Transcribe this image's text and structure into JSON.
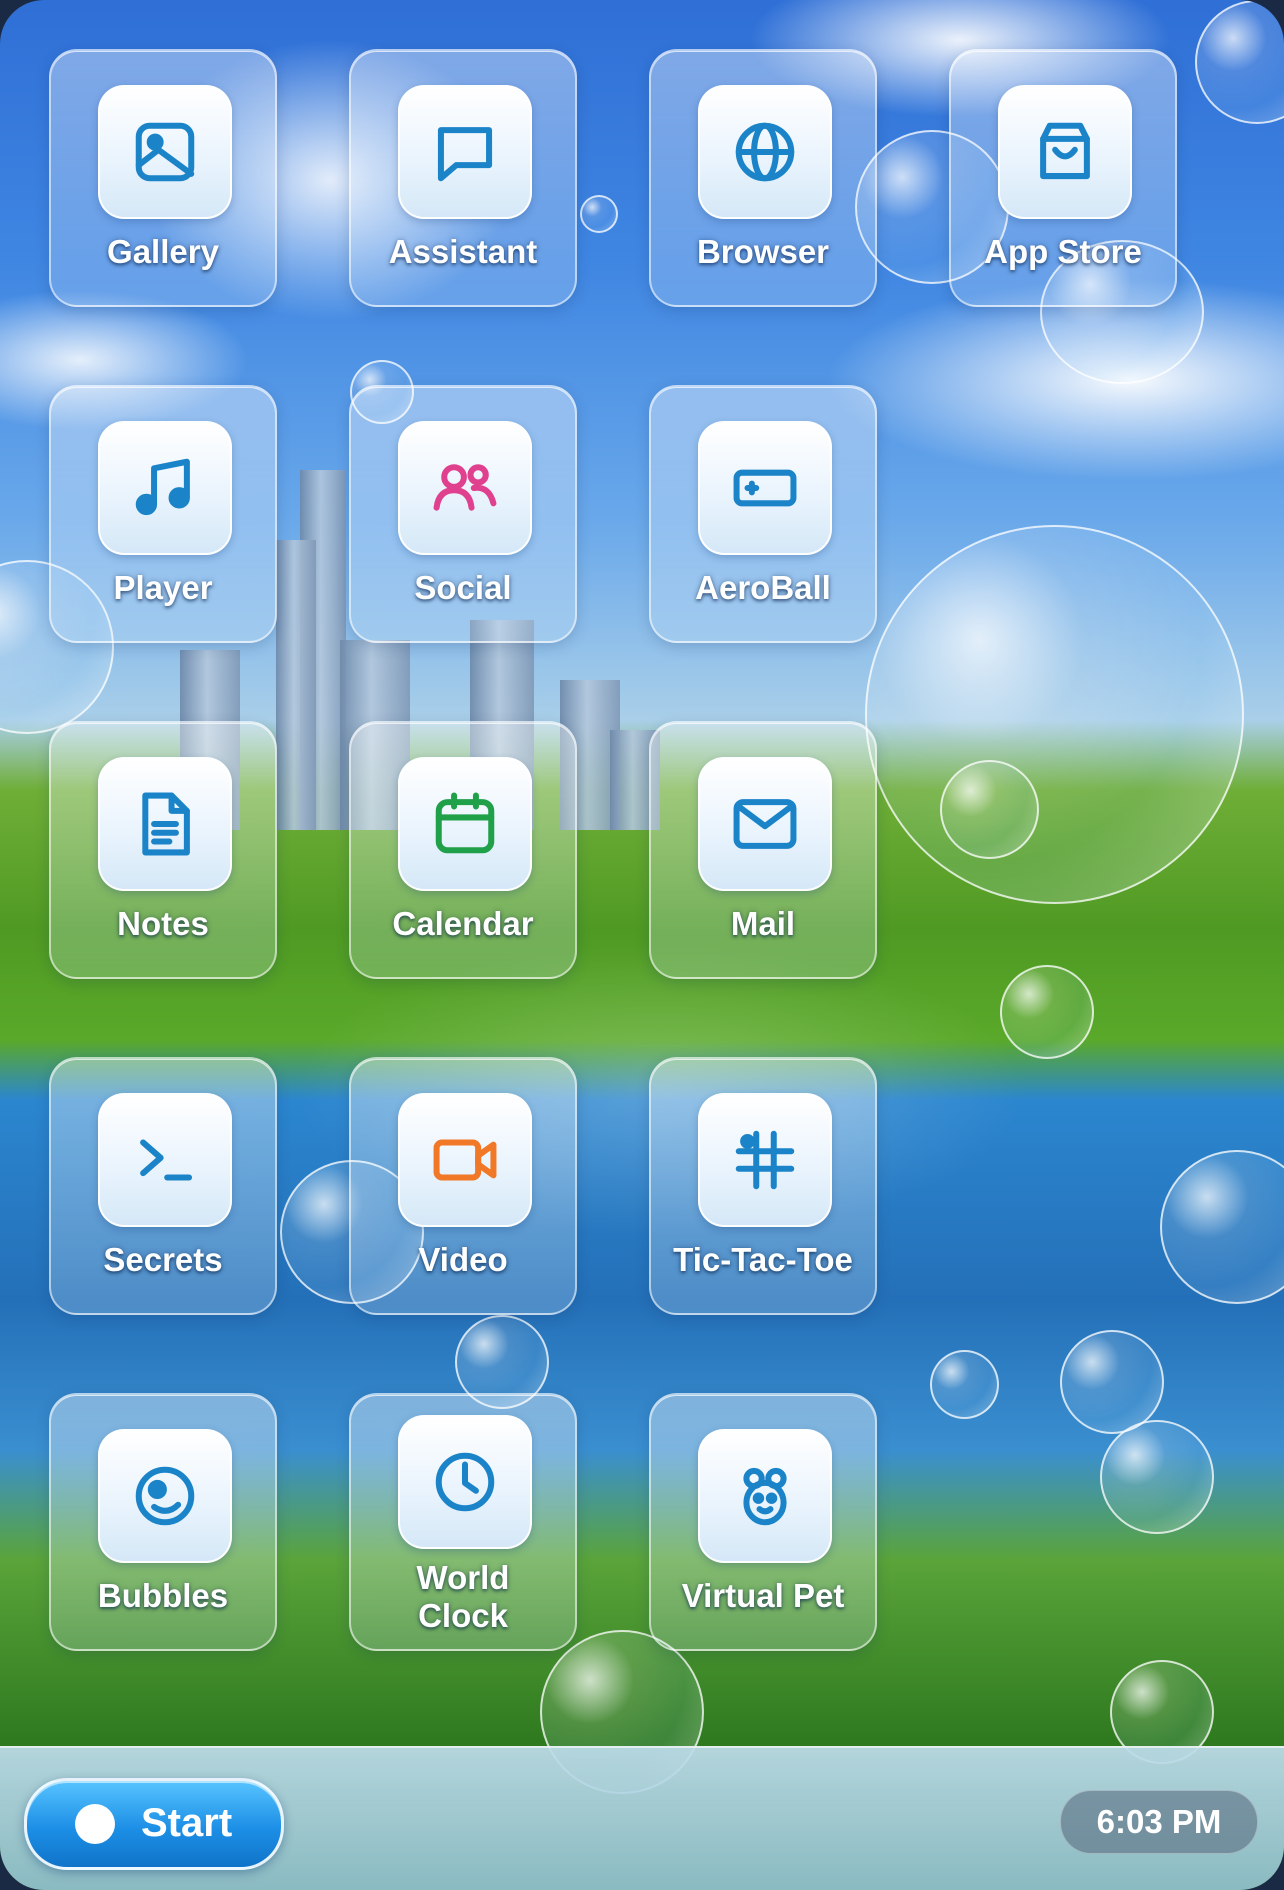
{
  "colors": {
    "icon_blue": "#1b84c9",
    "icon_pink": "#e0418f",
    "icon_green": "#21a04a",
    "icon_orange": "#f07826",
    "start_blue": "#1d8fe6"
  },
  "apps": [
    {
      "label": "Gallery",
      "icon": "image-icon"
    },
    {
      "label": "Assistant",
      "icon": "chat-bubble-icon"
    },
    {
      "label": "Browser",
      "icon": "globe-icon"
    },
    {
      "label": "App Store",
      "icon": "shopping-bag-icon"
    },
    {
      "label": "Player",
      "icon": "music-note-icon"
    },
    {
      "label": "Social",
      "icon": "users-icon"
    },
    {
      "label": "AeroBall",
      "icon": "gamepad-icon"
    },
    {
      "label": "Notes",
      "icon": "document-icon"
    },
    {
      "label": "Calendar",
      "icon": "calendar-icon"
    },
    {
      "label": "Mail",
      "icon": "envelope-icon"
    },
    {
      "label": "Secrets",
      "icon": "terminal-icon"
    },
    {
      "label": "Video",
      "icon": "video-camera-icon"
    },
    {
      "label": "Tic-Tac-Toe",
      "icon": "hash-grid-icon"
    },
    {
      "label": "Bubbles",
      "icon": "bubble-face-icon"
    },
    {
      "label": "World\nClock",
      "icon": "clock-icon"
    },
    {
      "label": "Virtual Pet",
      "icon": "bear-icon"
    }
  ],
  "taskbar": {
    "start_label": "Start",
    "time": "6:03 PM"
  }
}
